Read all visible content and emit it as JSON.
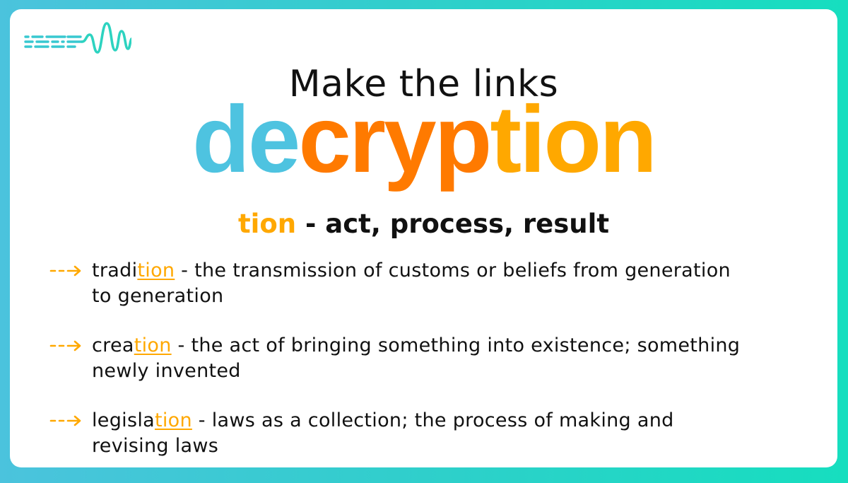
{
  "slide": {
    "heading": "Make the links",
    "word": {
      "prefix": "de",
      "root": "cryp",
      "suffix": "tion"
    },
    "suffix_definition": {
      "suffix": "tion",
      "meaning": " - act, process, result"
    },
    "examples": [
      {
        "stem": "tradi",
        "suffix": "tion",
        "definition": " - the transmission of customs or beliefs from generation to generation"
      },
      {
        "stem": "crea",
        "suffix": "tion",
        "definition": " - the act of bringing something into existence; something newly invented"
      },
      {
        "stem": "legisla",
        "suffix": "tion",
        "definition": " - laws as a collection; the process of making and revising laws"
      }
    ],
    "icons": {
      "logo": "sound-wave-logo-icon",
      "bullet": "dashed-arrow-icon"
    },
    "colors": {
      "prefix": "#4EC3E0",
      "root": "#FF7A00",
      "suffix": "#FFA800",
      "logo": "#2DD3C0"
    }
  }
}
